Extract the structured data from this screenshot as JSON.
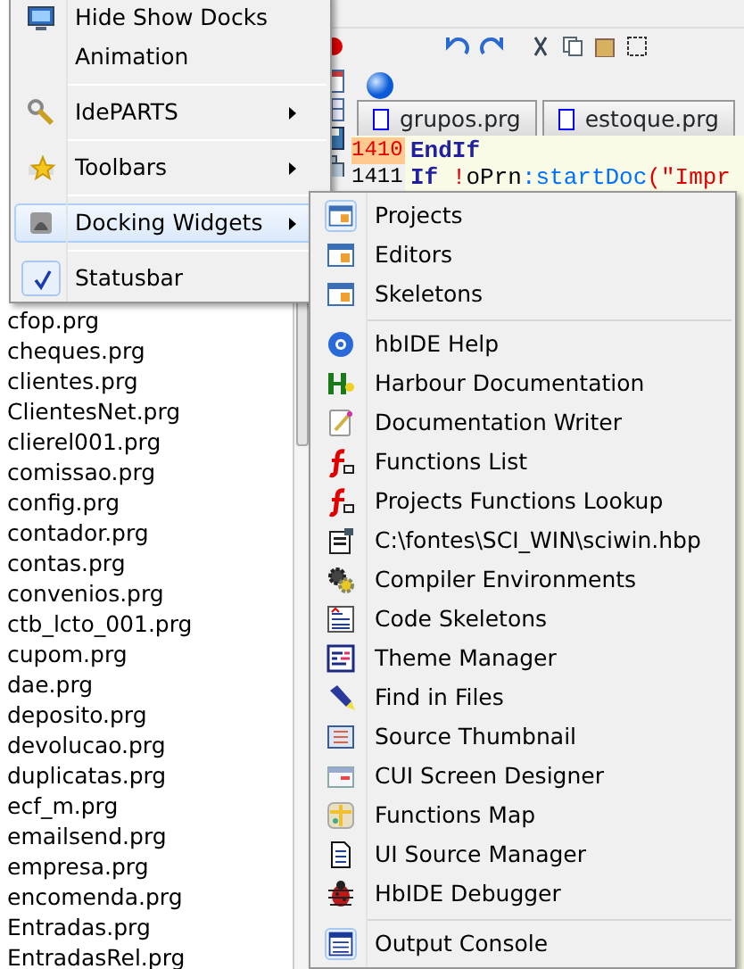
{
  "file_list": [
    "cfop.prg",
    "cheques.prg",
    "clientes.prg",
    "ClientesNet.prg",
    "clierel001.prg",
    "comissao.prg",
    "config.prg",
    "contador.prg",
    "contas.prg",
    "convenios.prg",
    "ctb_lcto_001.prg",
    "cupom.prg",
    "dae.prg",
    "deposito.prg",
    "devolucao.prg",
    "duplicatas.prg",
    "ecf_m.prg",
    "emailsend.prg",
    "empresa.prg",
    "encomenda.prg",
    "Entradas.prg",
    "EntradasRel.prg"
  ],
  "editor": {
    "tabs": [
      {
        "label": "grupos.prg",
        "selected": false
      },
      {
        "label": "estoque.prg",
        "selected": false
      }
    ],
    "lines": [
      {
        "number": "1410",
        "current": true,
        "segments": [
          {
            "kind": "keyword",
            "text": "EndIf"
          }
        ]
      },
      {
        "number": "1411",
        "current": false,
        "segments": [
          {
            "kind": "keyword",
            "text": "If"
          },
          {
            "kind": "operator",
            "text": " !"
          },
          {
            "kind": "plain",
            "text": "oPrn"
          },
          {
            "kind": "method",
            "text": ":startDoc"
          },
          {
            "kind": "operator",
            "text": "("
          },
          {
            "kind": "string",
            "text": "\"Impr"
          }
        ]
      }
    ]
  },
  "menu": {
    "items": [
      {
        "kind": "item",
        "label": "Hide Show Docks",
        "selected": false,
        "checked": false,
        "submenu": false
      },
      {
        "kind": "item",
        "label": "Animation",
        "selected": false,
        "checked": false,
        "submenu": false
      },
      {
        "kind": "separator"
      },
      {
        "kind": "item",
        "label": "IdePARTS",
        "selected": false,
        "checked": false,
        "submenu": true
      },
      {
        "kind": "separator"
      },
      {
        "kind": "item",
        "label": "Toolbars",
        "selected": false,
        "checked": false,
        "submenu": true
      },
      {
        "kind": "separator"
      },
      {
        "kind": "item",
        "label": "Docking Widgets",
        "selected": true,
        "checked": false,
        "submenu": true
      },
      {
        "kind": "separator"
      },
      {
        "kind": "item",
        "label": "Statusbar",
        "selected": false,
        "checked": true,
        "submenu": false
      }
    ]
  },
  "submenu": {
    "items": [
      {
        "kind": "item",
        "label": "Projects",
        "checked": true
      },
      {
        "kind": "item",
        "label": "Editors",
        "checked": false
      },
      {
        "kind": "item",
        "label": "Skeletons",
        "checked": false
      },
      {
        "kind": "separator"
      },
      {
        "kind": "item",
        "label": "hbIDE Help",
        "checked": false
      },
      {
        "kind": "item",
        "label": "Harbour Documentation",
        "checked": false
      },
      {
        "kind": "item",
        "label": "Documentation Writer",
        "checked": false
      },
      {
        "kind": "item",
        "label": "Functions List",
        "checked": false
      },
      {
        "kind": "item",
        "label": "Projects Functions Lookup",
        "checked": false
      },
      {
        "kind": "item",
        "label": "C:\\fontes\\SCI_WIN\\sciwin.hbp",
        "checked": false
      },
      {
        "kind": "item",
        "label": "Compiler Environments",
        "checked": false
      },
      {
        "kind": "item",
        "label": "Code Skeletons",
        "checked": false
      },
      {
        "kind": "item",
        "label": "Theme Manager",
        "checked": false
      },
      {
        "kind": "item",
        "label": "Find in Files",
        "checked": false
      },
      {
        "kind": "item",
        "label": "Source Thumbnail",
        "checked": false
      },
      {
        "kind": "item",
        "label": "CUI Screen Designer",
        "checked": false
      },
      {
        "kind": "item",
        "label": "Functions Map",
        "checked": false
      },
      {
        "kind": "item",
        "label": "UI Source Manager",
        "checked": false
      },
      {
        "kind": "item",
        "label": "HbIDE Debugger",
        "checked": false
      },
      {
        "kind": "separator"
      },
      {
        "kind": "item",
        "label": "Output Console",
        "checked": true
      }
    ]
  }
}
